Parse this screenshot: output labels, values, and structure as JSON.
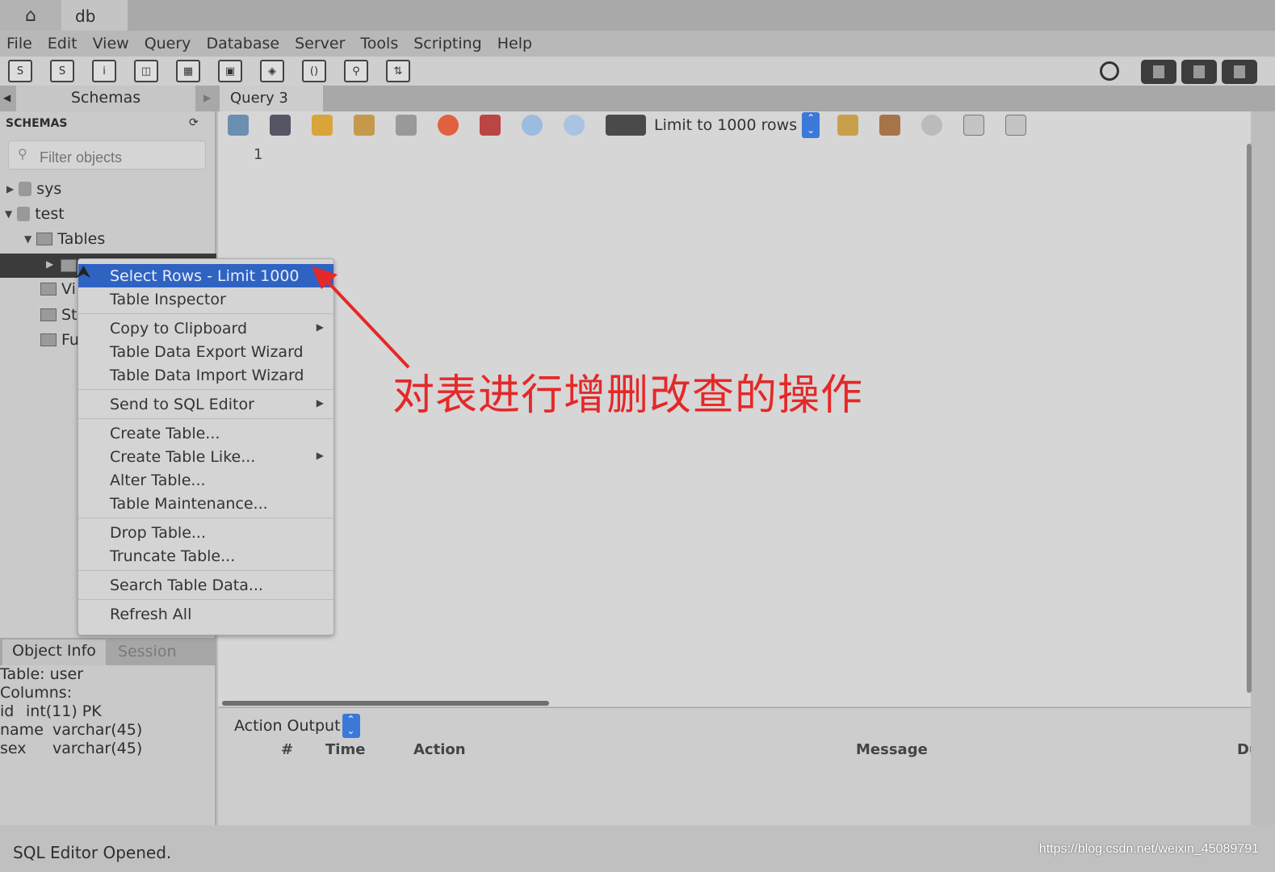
{
  "window": {
    "tab_db": "db"
  },
  "menu": [
    "File",
    "Edit",
    "View",
    "Query",
    "Database",
    "Server",
    "Tools",
    "Scripting",
    "Help"
  ],
  "toolbar_icons": [
    "new-sql-tab-icon",
    "open-sql-file-icon",
    "schema-inspector-icon",
    "create-schema-icon",
    "create-table-icon",
    "create-view-icon",
    "create-procedure-icon",
    "create-function-icon",
    "search-table-data-icon",
    "reconnect-icon"
  ],
  "tabs": {
    "schemas": "Schemas",
    "query": "Query 3"
  },
  "sidebar": {
    "header": "SCHEMAS",
    "filter_placeholder": "Filter objects",
    "tree": [
      {
        "label": "sys",
        "expanded": false
      },
      {
        "label": "test",
        "expanded": true
      }
    ],
    "tables_label": "Tables",
    "partial": [
      "Vi",
      "St",
      "Fu"
    ]
  },
  "editor": {
    "line_number": "1",
    "limit": "Limit to 1000 rows"
  },
  "context_menu": {
    "groups": [
      [
        {
          "label": "Select Rows - Limit 1000",
          "highlighted": true
        },
        {
          "label": "Table Inspector"
        }
      ],
      [
        {
          "label": "Copy to Clipboard",
          "submenu": true
        },
        {
          "label": "Table Data Export Wizard"
        },
        {
          "label": "Table Data Import Wizard"
        }
      ],
      [
        {
          "label": "Send to SQL Editor",
          "submenu": true
        }
      ],
      [
        {
          "label": "Create Table..."
        },
        {
          "label": "Create Table Like...",
          "submenu": true
        },
        {
          "label": "Alter Table..."
        },
        {
          "label": "Table Maintenance..."
        }
      ],
      [
        {
          "label": "Drop Table..."
        },
        {
          "label": "Truncate Table..."
        }
      ],
      [
        {
          "label": "Search Table Data..."
        }
      ],
      [
        {
          "label": "Refresh All"
        }
      ]
    ]
  },
  "annotation": {
    "text": "对表进行增删改查的操作",
    "color": "#e52828"
  },
  "object_info": {
    "tab_info": "Object Info",
    "tab_session": "Session",
    "lines": [
      "Table: user",
      "Columns:"
    ],
    "columns": [
      {
        "name": "id",
        "type": "int(11) PK"
      },
      {
        "name": "name",
        "type": "varchar(45)"
      },
      {
        "name": "sex",
        "type": "varchar(45)"
      }
    ]
  },
  "output": {
    "selector": "Action Output",
    "columns": [
      "#",
      "Time",
      "Action",
      "Message",
      "Du"
    ]
  },
  "status": "SQL Editor Opened.",
  "watermark": "https://blog.csdn.net/weixin_45089791",
  "colors": {
    "selection": "#2f63c2",
    "spinner": "#3c78d8"
  }
}
